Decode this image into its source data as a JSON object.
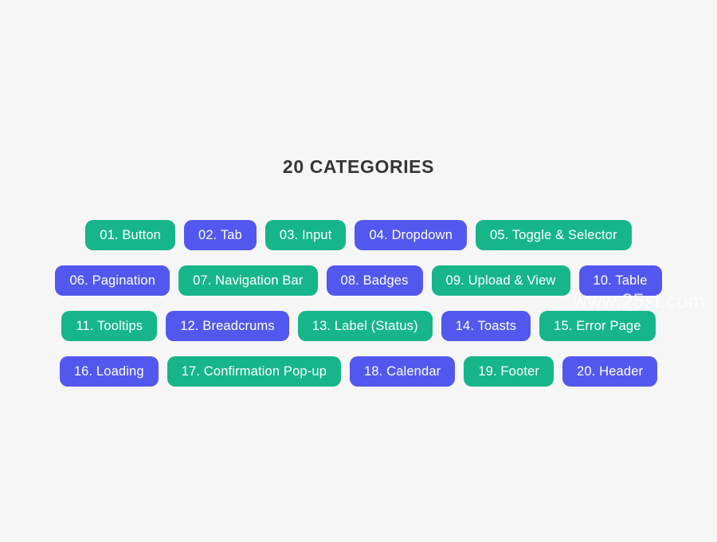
{
  "page": {
    "title": "20 CATEGORIES",
    "background_color": "#f7f6f6",
    "title_color": "#363636"
  },
  "colors": {
    "green": "#16b68a",
    "purple": "#5258ee",
    "tag_text": "#ffffff"
  },
  "watermark": {
    "text": "www.25xt.com"
  },
  "rows": [
    {
      "tags": [
        {
          "label": "01. Button",
          "color": "green"
        },
        {
          "label": "02. Tab",
          "color": "purple"
        },
        {
          "label": "03. Input",
          "color": "green"
        },
        {
          "label": "04. Dropdown",
          "color": "purple"
        },
        {
          "label": "05. Toggle & Selector",
          "color": "green"
        }
      ]
    },
    {
      "tags": [
        {
          "label": "06. Pagination",
          "color": "purple"
        },
        {
          "label": "07. Navigation Bar",
          "color": "green"
        },
        {
          "label": "08. Badges",
          "color": "purple"
        },
        {
          "label": "09. Upload & View",
          "color": "green"
        },
        {
          "label": "10. Table",
          "color": "purple"
        }
      ]
    },
    {
      "tags": [
        {
          "label": "11. Tooltips",
          "color": "green"
        },
        {
          "label": "12. Breadcrums",
          "color": "purple"
        },
        {
          "label": "13. Label (Status)",
          "color": "green"
        },
        {
          "label": "14. Toasts",
          "color": "purple"
        },
        {
          "label": "15. Error Page",
          "color": "green"
        }
      ]
    },
    {
      "tags": [
        {
          "label": "16. Loading",
          "color": "purple"
        },
        {
          "label": "17. Confirmation Pop-up",
          "color": "green"
        },
        {
          "label": "18. Calendar",
          "color": "purple"
        },
        {
          "label": "19. Footer",
          "color": "green"
        },
        {
          "label": "20. Header",
          "color": "purple"
        }
      ]
    }
  ]
}
